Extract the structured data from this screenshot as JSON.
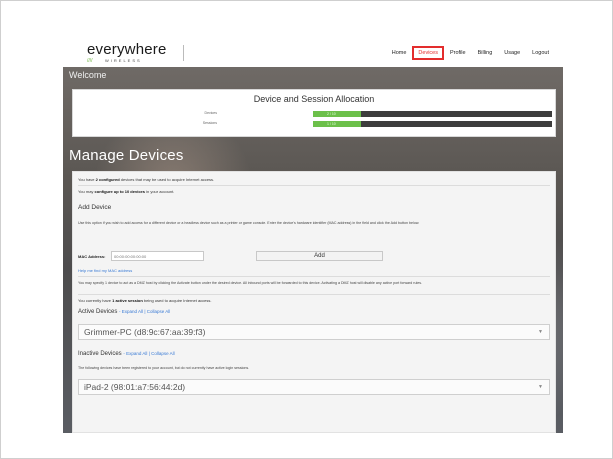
{
  "brand": {
    "logo_text": "everywhere",
    "logo_sub": "WIRELESS",
    "logo_dots": "////",
    "accent_green": "#6cb33f"
  },
  "nav": {
    "items": [
      {
        "label": "Home",
        "active": false
      },
      {
        "label": "Devices",
        "active": true
      },
      {
        "label": "Profile",
        "active": false
      },
      {
        "label": "Billing",
        "active": false
      },
      {
        "label": "Usage",
        "active": false
      },
      {
        "label": "Logout",
        "active": false
      }
    ],
    "highlight_color": "#e32d2d"
  },
  "welcome": "Welcome",
  "allocation": {
    "title": "Device and Session Allocation",
    "rows": [
      {
        "label": "Devices",
        "value": "2 / 10",
        "fraction": 0.2
      },
      {
        "label": "Sessions",
        "value": "1 / 10",
        "fraction": 0.2
      }
    ]
  },
  "manage": {
    "title": "Manage Devices",
    "configured_line": {
      "pre": "You have ",
      "bold": "2 configured",
      "post": " devices that may be used to acquire Internet access."
    },
    "limit_line": {
      "pre": "You may ",
      "bold": "configure up to 10 devices",
      "post": " in your account."
    },
    "add_device": {
      "heading": "Add Device",
      "description": "Use this option if you wish to add access for a different device or a headless device such as a printer or game console. Enter the device's hardware identifier (MAC address) in the field and click the Add button below.",
      "mac_label": "MAC Address:",
      "mac_placeholder": "00:00:00:00:00:00",
      "mac_value": "",
      "add_button": "Add",
      "help_link": "Help me find my MAC address"
    },
    "dmz_text": "You may specify 1 device to act as a DMZ host by clicking the Activate button under the desired device. All inbound ports will be forwarded to this device. Activating a DMZ host will disable any active port forward rules.",
    "session_line": {
      "pre": "You currently have ",
      "bold": "1 active session",
      "post": " being used to acquire Internet access."
    },
    "active": {
      "heading": "Active Devices",
      "expand": "Expand All",
      "separator": "|",
      "collapse": "Collapse All",
      "devices": [
        {
          "name": "Grimmer-PC (d8:9c:67:aa:39:f3)"
        }
      ]
    },
    "inactive": {
      "heading": "Inactive Devices",
      "expand": "Expand All",
      "separator": "|",
      "collapse": "Collapse All",
      "note": "The following devices have been registered to your account, but do not currently have active login sessions.",
      "devices": [
        {
          "name": "iPad-2 (98:01:a7:56:44:2d)"
        }
      ]
    }
  }
}
